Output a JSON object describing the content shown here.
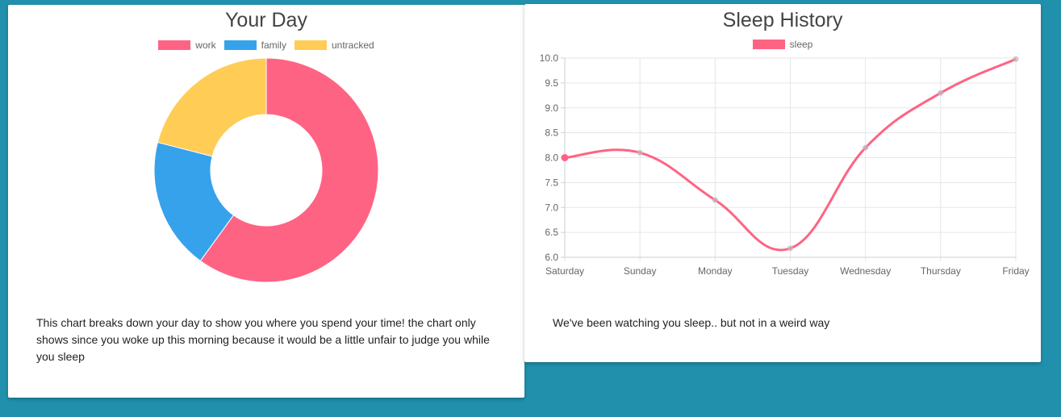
{
  "colors": {
    "background": "#2190ac",
    "work": "#ff6384",
    "family": "#36a2eb",
    "untracked": "#ffcd56",
    "sleep": "#ff6384",
    "grid": "#e5e5e5"
  },
  "day_card": {
    "title": "Your Day",
    "description": "This chart breaks down your day to show you where you spend your time! the chart only shows since you woke up this morning because it would be a little unfair to judge you while you sleep"
  },
  "sleep_card": {
    "title": "Sleep History",
    "description": "We've been watching you sleep.. but not in a weird way"
  },
  "chart_data": [
    {
      "type": "pie",
      "variant": "doughnut",
      "categories": [
        "work",
        "family",
        "untracked"
      ],
      "values": [
        60,
        19,
        21
      ],
      "colors": [
        "#ff6384",
        "#36a2eb",
        "#ffcd56"
      ],
      "legend": "top"
    },
    {
      "type": "line",
      "categories": [
        "Saturday",
        "Sunday",
        "Monday",
        "Tuesday",
        "Wednesday",
        "Thursday",
        "Friday"
      ],
      "series": [
        {
          "name": "sleep",
          "values": [
            8.0,
            8.1,
            7.15,
            6.18,
            8.2,
            9.3,
            9.98
          ],
          "color": "#ff6384"
        }
      ],
      "ylim": [
        6.0,
        10.0
      ],
      "yticks": [
        "10.0",
        "9.5",
        "9.0",
        "8.5",
        "8.0",
        "7.5",
        "7.0",
        "6.5",
        "6.0"
      ],
      "grid": true,
      "legend": "top"
    }
  ]
}
